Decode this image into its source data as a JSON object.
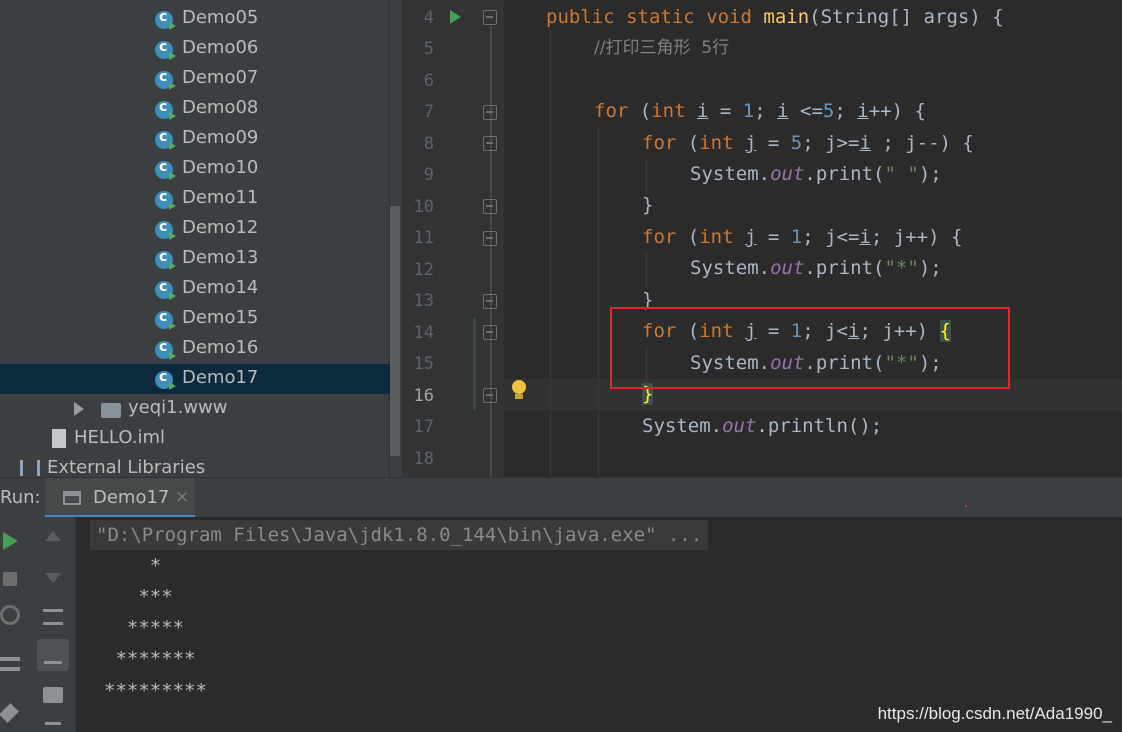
{
  "project_tree": {
    "classes": [
      "Demo05",
      "Demo06",
      "Demo07",
      "Demo08",
      "Demo09",
      "Demo10",
      "Demo11",
      "Demo12",
      "Demo13",
      "Demo14",
      "Demo15",
      "Demo16",
      "Demo17"
    ],
    "selected": "Demo17",
    "folder": "yeqi1.www",
    "iml_file": "HELLO.iml",
    "external_libraries": "External Libraries"
  },
  "editor": {
    "line_numbers": [
      "4",
      "5",
      "6",
      "7",
      "8",
      "9",
      "10",
      "11",
      "12",
      "13",
      "14",
      "15",
      "16",
      "17",
      "18"
    ],
    "current_line": "16",
    "tokens": {
      "public": "public",
      "static": "static",
      "void": "void",
      "main": "main",
      "main_params": "(String[] args) {",
      "comment": "//打印三角形  5行",
      "for": "for",
      "int": "int",
      "open_paren": " (",
      "i": "i",
      "j": "j",
      "l7_a": " = ",
      "l7_num1": "1",
      "l7_b": "; ",
      "l7_c": " <=",
      "l7_num5": "5",
      "l7_d": "; ",
      "l7_e": "++) {",
      "l8_a": " = ",
      "l8_num5": "5",
      "l8_b": "; j>=",
      "l8_c": " ; j--) {",
      "system": "System.",
      "out": "out",
      "print": ".print(",
      "close_stmt": ");",
      "str_space": "\" \"",
      "str_star": "\"*\"",
      "close_brace": "}",
      "l11_a": " = ",
      "l11_num1": "1",
      "l11_b": "; j<=",
      "l11_c": "; j++) {",
      "l14_a": " = ",
      "l14_num1": "1",
      "l14_b": "; j<",
      "l14_c": "; j++) ",
      "open_brace": "{",
      "println": ".println();"
    }
  },
  "run_panel": {
    "title": "Run:",
    "tab_label": "Demo17",
    "tab_close": "×",
    "command": "\"D:\\Program Files\\Java\\jdk1.8.0_144\\bin\\java.exe\" ...",
    "output": [
      "    *",
      "   ***",
      "  *****",
      " *******",
      "*********"
    ],
    "watermark": "https://blog.csdn.net/Ada1990_"
  },
  "colors": {
    "keyword": "#cc7832",
    "method": "#ffc66d",
    "number": "#6897bb",
    "string": "#6a8759",
    "field": "#9876aa",
    "highlight_box": "#e0262b"
  }
}
